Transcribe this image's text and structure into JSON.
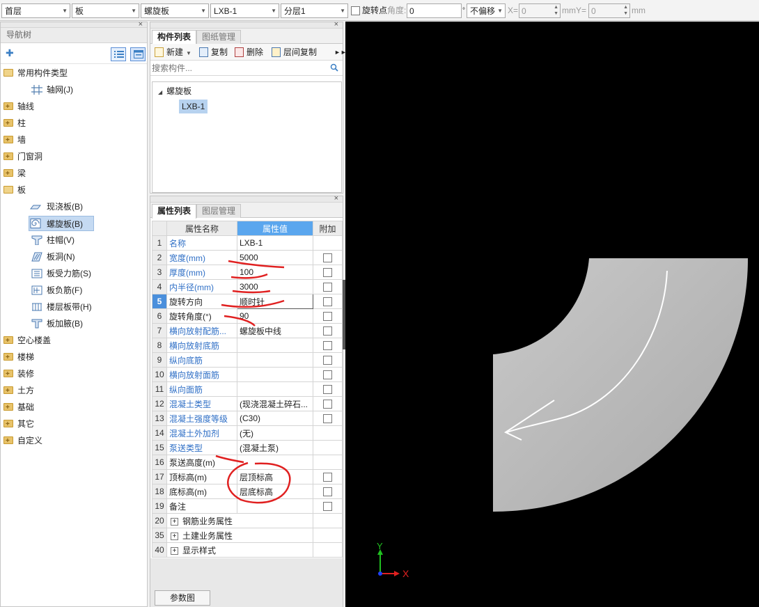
{
  "toolbar": {
    "floor": "首层",
    "category": "板",
    "type": "螺旋板",
    "component": "LXB-1",
    "layer": "分层1",
    "rotate_point_label": "旋转点",
    "angle_label": "角度:",
    "angle_value": "0",
    "degree_unit": "°",
    "offset_mode": "不偏移",
    "x_label": "X=",
    "x_value": "0",
    "mm_y_label": "mmY=",
    "y_value": "0",
    "mm_label": "mm"
  },
  "nav": {
    "title": "导航树",
    "items": [
      {
        "label": "常用构件类型",
        "kind": "folder-open"
      },
      {
        "label": "轴网(J)",
        "kind": "child"
      },
      {
        "label": "轴线",
        "kind": "folder"
      },
      {
        "label": "柱",
        "kind": "folder"
      },
      {
        "label": "墙",
        "kind": "folder"
      },
      {
        "label": "门窗洞",
        "kind": "folder"
      },
      {
        "label": "梁",
        "kind": "folder"
      },
      {
        "label": "板",
        "kind": "folder-open"
      },
      {
        "label": "现浇板(B)",
        "kind": "child"
      },
      {
        "label": "螺旋板(B)",
        "kind": "child-selected"
      },
      {
        "label": "柱帽(V)",
        "kind": "child"
      },
      {
        "label": "板洞(N)",
        "kind": "child"
      },
      {
        "label": "板受力筋(S)",
        "kind": "child"
      },
      {
        "label": "板负筋(F)",
        "kind": "child"
      },
      {
        "label": "楼层板带(H)",
        "kind": "child"
      },
      {
        "label": "板加腋(B)",
        "kind": "child"
      },
      {
        "label": "空心楼盖",
        "kind": "folder"
      },
      {
        "label": "楼梯",
        "kind": "folder"
      },
      {
        "label": "装修",
        "kind": "folder"
      },
      {
        "label": "土方",
        "kind": "folder"
      },
      {
        "label": "基础",
        "kind": "folder"
      },
      {
        "label": "其它",
        "kind": "folder"
      },
      {
        "label": "自定义",
        "kind": "folder"
      }
    ]
  },
  "component_list": {
    "tabs": [
      "构件列表",
      "图纸管理"
    ],
    "actions": {
      "new": "新建",
      "copy": "复制",
      "delete": "删除",
      "floor_copy": "层间复制"
    },
    "search_placeholder": "搜索构件...",
    "tree_root": "螺旋板",
    "tree_child": "LXB-1"
  },
  "properties": {
    "tabs": [
      "属性列表",
      "图层管理"
    ],
    "headers": {
      "name": "属性名称",
      "value": "属性值",
      "extra": "附加"
    },
    "rows": [
      {
        "no": "1",
        "name": "名称",
        "value": "LXB-1",
        "blue": true,
        "check": false
      },
      {
        "no": "2",
        "name": "宽度(mm)",
        "value": "5000",
        "blue": true,
        "check": true
      },
      {
        "no": "3",
        "name": "厚度(mm)",
        "value": "100",
        "blue": true,
        "check": true
      },
      {
        "no": "4",
        "name": "内半径(mm)",
        "value": "3000",
        "blue": true,
        "check": true
      },
      {
        "no": "5",
        "name": "旋转方向",
        "value": "顺时针",
        "blue": false,
        "check": true
      },
      {
        "no": "6",
        "name": "旋转角度(°)",
        "value": "90",
        "blue": false,
        "check": true
      },
      {
        "no": "7",
        "name": "横向放射配筋...",
        "value": "螺旋板中线",
        "blue": true,
        "check": true
      },
      {
        "no": "8",
        "name": "横向放射底筋",
        "value": "",
        "blue": true,
        "check": true
      },
      {
        "no": "9",
        "name": "纵向底筋",
        "value": "",
        "blue": true,
        "check": true
      },
      {
        "no": "10",
        "name": "横向放射面筋",
        "value": "",
        "blue": true,
        "check": true
      },
      {
        "no": "11",
        "name": "纵向面筋",
        "value": "",
        "blue": true,
        "check": true
      },
      {
        "no": "12",
        "name": "混凝土类型",
        "value": "(现浇混凝土碎石...",
        "blue": true,
        "check": true
      },
      {
        "no": "13",
        "name": "混凝土强度等级",
        "value": "(C30)",
        "blue": true,
        "check": true
      },
      {
        "no": "14",
        "name": "混凝土外加剂",
        "value": "(无)",
        "blue": true,
        "check": false
      },
      {
        "no": "15",
        "name": "泵送类型",
        "value": "(混凝土泵)",
        "blue": true,
        "check": false
      },
      {
        "no": "16",
        "name": "泵送高度(m)",
        "value": "",
        "blue": false,
        "check": false
      },
      {
        "no": "17",
        "name": "顶标高(m)",
        "value": "层顶标高",
        "blue": false,
        "check": true
      },
      {
        "no": "18",
        "name": "底标高(m)",
        "value": "层底标高",
        "blue": false,
        "check": true
      },
      {
        "no": "19",
        "name": "备注",
        "value": "",
        "blue": false,
        "check": true
      }
    ],
    "groups": [
      {
        "no": "20",
        "name": "钢筋业务属性"
      },
      {
        "no": "35",
        "name": "土建业务属性"
      },
      {
        "no": "40",
        "name": "显示样式"
      }
    ],
    "param_button": "参数图"
  },
  "viewport": {
    "axis_x": "X",
    "axis_y": "Y"
  }
}
